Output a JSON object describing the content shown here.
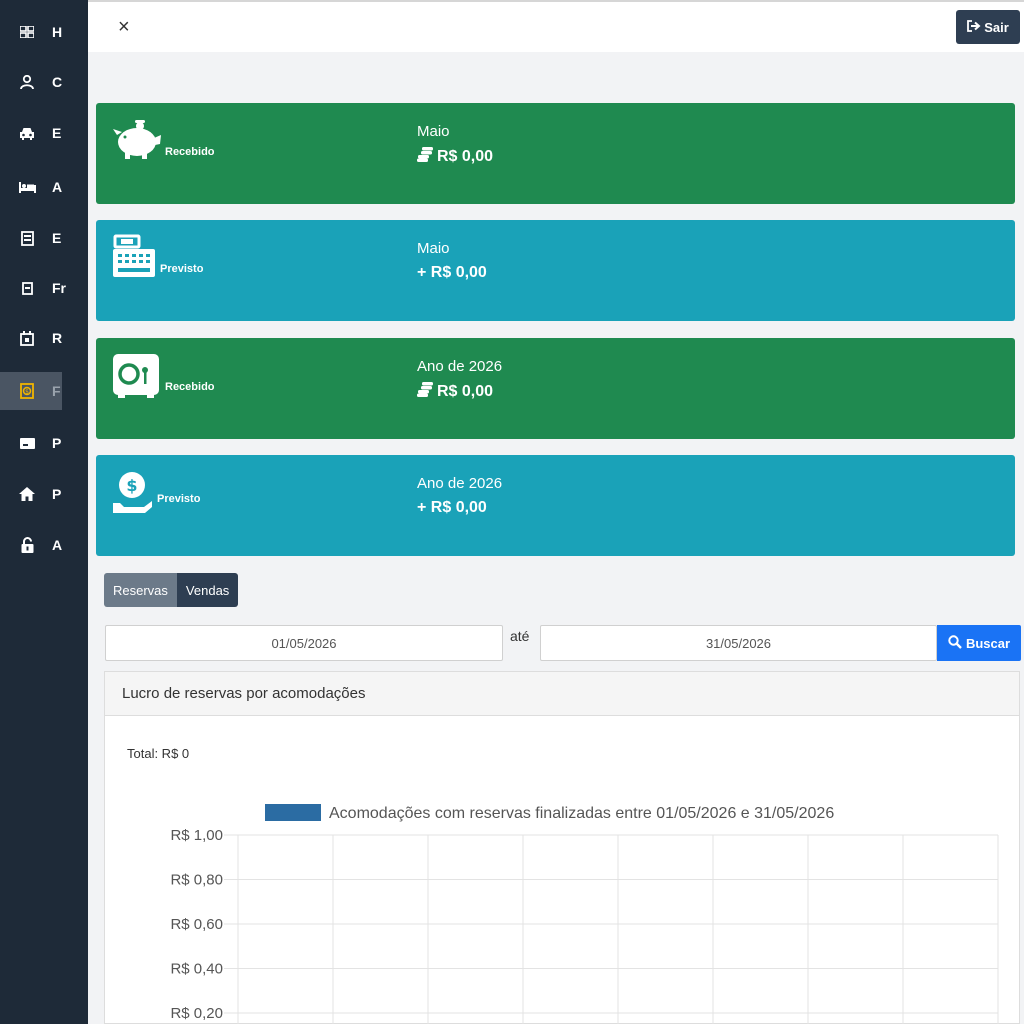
{
  "sidebar": {
    "items": [
      {
        "label": "H",
        "icon": "dashboard-icon"
      },
      {
        "label": "C",
        "icon": "user-icon"
      },
      {
        "label": "E",
        "icon": "car-icon"
      },
      {
        "label": "A",
        "icon": "bed-icon"
      },
      {
        "label": "E",
        "icon": "ledger-icon"
      },
      {
        "label": "Fr",
        "icon": "calendar-page-icon"
      },
      {
        "label": "R",
        "icon": "calendar-icon"
      },
      {
        "label": "F",
        "icon": "finance-icon",
        "active": true
      },
      {
        "label": "P",
        "icon": "card-icon"
      },
      {
        "label": "P",
        "icon": "home-icon"
      },
      {
        "label": "A",
        "icon": "lock-icon"
      }
    ]
  },
  "topbar": {
    "close_label": "×",
    "logout_label": "Sair"
  },
  "cards": [
    {
      "tag": "Recebido",
      "period": "Maio",
      "amount": "R$ 0,00",
      "prefix_icon": "coins-icon",
      "color": "#1f8a50",
      "icon": "piggy-bank-icon"
    },
    {
      "tag": "Previsto",
      "period": "Maio",
      "amount": "+ R$ 0,00",
      "prefix_icon": "",
      "color": "#1aa2b8",
      "icon": "cash-register-icon"
    },
    {
      "tag": "Recebido",
      "period": "Ano de 2026",
      "amount": "R$ 0,00",
      "prefix_icon": "coins-icon",
      "color": "#1f8a50",
      "icon": "safe-icon"
    },
    {
      "tag": "Previsto",
      "period": "Ano de 2026",
      "amount": "+ R$ 0,00",
      "prefix_icon": "",
      "color": "#1aa2b8",
      "icon": "hand-coin-icon"
    }
  ],
  "toggle": {
    "reservas": "Reservas",
    "vendas": "Vendas",
    "active": "reservas"
  },
  "filter": {
    "start_date": "01/05/2026",
    "separator": "até",
    "end_date": "31/05/2026",
    "search_label": "Buscar"
  },
  "panel": {
    "title": "Lucro de reservas por acomodações",
    "total_label": "Total: R$ 0"
  },
  "colors": {
    "sidebar": "#1e2a38",
    "green": "#1f8a50",
    "teal": "#1aa2b8",
    "primary": "#1a73f5",
    "series": "#2b6ca3"
  },
  "chart_data": {
    "type": "bar",
    "legend": "Acomodações com reservas finalizadas entre 01/05/2026 e 31/05/2026",
    "y_ticks": [
      "R$ 1,00",
      "R$ 0,80",
      "R$ 0,60",
      "R$ 0,40",
      "R$ 0,20"
    ],
    "y_range": [
      0,
      1
    ],
    "categories": [],
    "series": [
      {
        "name": "Acomodações com reservas finalizadas entre 01/05/2026 e 31/05/2026",
        "values": []
      }
    ],
    "grid": true,
    "legend_position": "top"
  }
}
